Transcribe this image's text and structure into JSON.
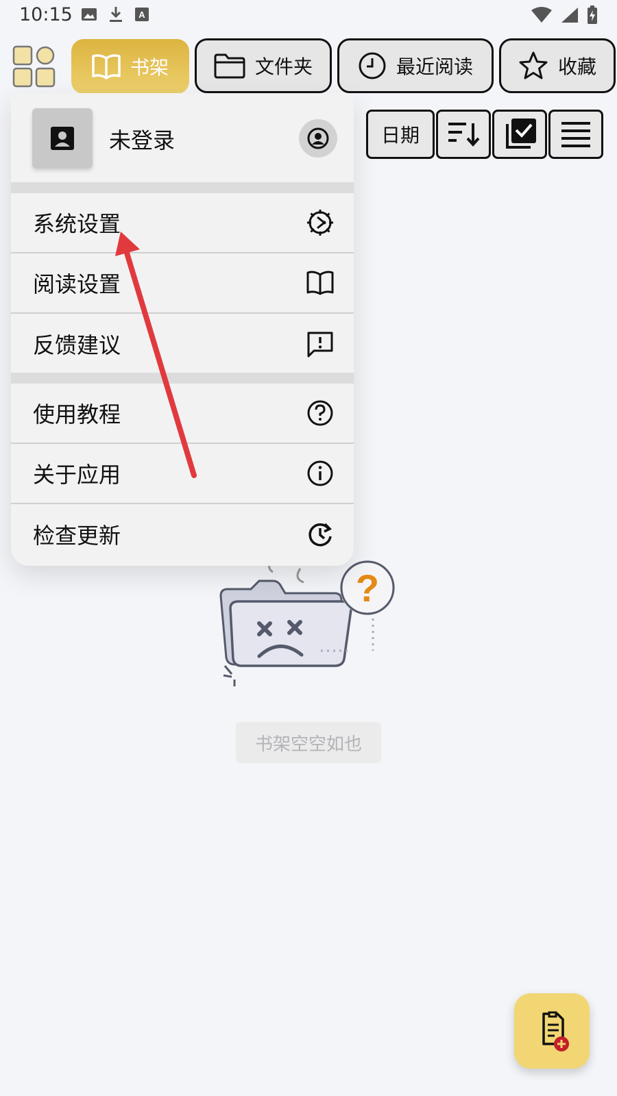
{
  "status_bar": {
    "time": "10:15",
    "left_icons": [
      "image-icon",
      "download-icon",
      "a-notification-icon"
    ],
    "right_icons": [
      "wifi-icon",
      "signal-icon",
      "battery-charging-icon"
    ]
  },
  "top_nav": {
    "tabs": [
      {
        "label": "书架",
        "icon": "book-icon",
        "active": true
      },
      {
        "label": "文件夹",
        "icon": "folder-icon",
        "active": false
      },
      {
        "label": "最近阅读",
        "icon": "clock-icon",
        "active": false
      },
      {
        "label": "收藏",
        "icon": "star-icon",
        "active": false
      }
    ]
  },
  "toolbar": {
    "sort_label": "日期",
    "icons": [
      "sort-descending-icon",
      "multi-select-icon",
      "list-view-icon"
    ]
  },
  "menu": {
    "account_name": "未登录",
    "groups": [
      [
        {
          "label": "系统设置",
          "icon": "gear-icon"
        },
        {
          "label": "阅读设置",
          "icon": "open-book-icon"
        },
        {
          "label": "反馈建议",
          "icon": "feedback-icon"
        }
      ],
      [
        {
          "label": "使用教程",
          "icon": "help-icon"
        },
        {
          "label": "关于应用",
          "icon": "info-icon"
        },
        {
          "label": "检查更新",
          "icon": "update-icon"
        }
      ]
    ]
  },
  "empty_state": {
    "label": "书架空空如也"
  },
  "colors": {
    "accent_gold": "#dcb440",
    "fab_yellow": "#f2d673",
    "annotation_red": "#e03a3e",
    "question_orange": "#e58a16"
  }
}
